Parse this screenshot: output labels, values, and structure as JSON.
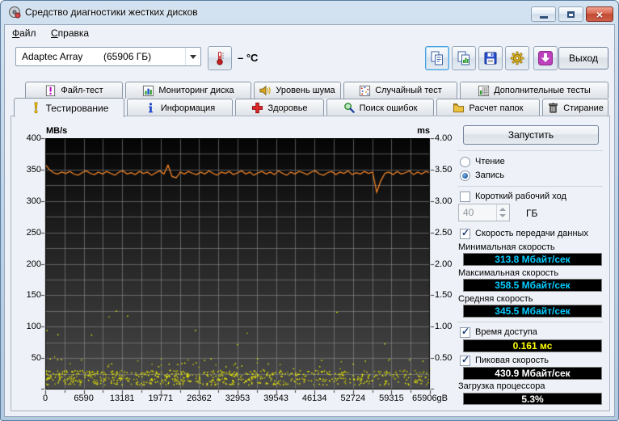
{
  "window": {
    "title": "Средство диагностики жестких дисков"
  },
  "menu": {
    "file": {
      "accel": "Ф",
      "rest": "айл"
    },
    "help": {
      "accel": "С",
      "rest": "правка"
    }
  },
  "toolbar": {
    "drive_name": "Adaptec Array",
    "drive_size": "(65906 ГБ)",
    "temperature": "– °C",
    "exit_label": "Выход"
  },
  "tabs": {
    "row1": [
      {
        "label": "Файл-тест"
      },
      {
        "label": "Мониторинг диска"
      },
      {
        "label": "Уровень шума"
      },
      {
        "label": "Случайный тест"
      },
      {
        "label": "Дополнительные тесты"
      }
    ],
    "row2": [
      {
        "label": "Тестирование",
        "active": true
      },
      {
        "label": "Информация"
      },
      {
        "label": "Здоровье"
      },
      {
        "label": "Поиск ошибок"
      },
      {
        "label": "Расчет папок"
      },
      {
        "label": "Стирание"
      }
    ]
  },
  "panel": {
    "start_button": "Запустить",
    "radio_read": "Чтение",
    "read_selected": false,
    "radio_write": "Запись",
    "write_selected": true,
    "short_stroke_label": "Короткий рабочий ход",
    "short_stroke_checked": false,
    "short_stroke_value": "40",
    "short_stroke_unit": "ГБ",
    "transfer_label": "Скорость передачи данных",
    "transfer_checked": true,
    "min_speed_label": "Минимальная скорость",
    "min_speed_value": "313.8 Мбайт/сек",
    "max_speed_label": "Максимальная скорость",
    "max_speed_value": "358.5 Мбайт/сек",
    "avg_speed_label": "Средняя скорость",
    "avg_speed_value": "345.5 Мбайт/сек",
    "access_time_label": "Время доступа",
    "access_time_checked": true,
    "access_time_value": "0.161 мс",
    "burst_label": "Пиковая скорость",
    "burst_checked": true,
    "burst_value": "430.9 Мбайт/сек",
    "cpu_label": "Загрузка процессора",
    "cpu_value": "5.3%"
  },
  "chart_data": {
    "type": "line+scatter",
    "left_axis": {
      "label": "MB/s",
      "min": 0,
      "max": 400,
      "ticks": [
        400,
        350,
        300,
        250,
        200,
        150,
        100,
        50
      ]
    },
    "right_axis": {
      "label": "ms",
      "min": 0,
      "max": 4,
      "ticks": [
        "4.00",
        "3.50",
        "3.00",
        "2.50",
        "2.00",
        "1.50",
        "1.00",
        "0.50"
      ]
    },
    "x_axis": {
      "min": 0,
      "max": 65906,
      "tick_labels": [
        "0",
        "6590",
        "13181",
        "19771",
        "26362",
        "32953",
        "39543",
        "46134",
        "52724",
        "59315",
        "65906gB"
      ]
    },
    "series": [
      {
        "name": "Скорость передачи данных",
        "unit": "MB/s",
        "color": "#ff8a28",
        "values": [
          358.5,
          350,
          345,
          343,
          346,
          344,
          347,
          343,
          341,
          345,
          348,
          344,
          342,
          346,
          343,
          347,
          344,
          341,
          346,
          348,
          343,
          345,
          342,
          347,
          344,
          346,
          341,
          345,
          348,
          343,
          357,
          339,
          337,
          346,
          343,
          347,
          344,
          342,
          346,
          343,
          348,
          344,
          341,
          346,
          344,
          347,
          342,
          345,
          348,
          343,
          346,
          341,
          345,
          347,
          343,
          346,
          342,
          348,
          344,
          341,
          346,
          343,
          347,
          345,
          342,
          346,
          348,
          343,
          341,
          345,
          347,
          342,
          346,
          344,
          348,
          342,
          345,
          343,
          347,
          344,
          346,
          313.8,
          332,
          344,
          346,
          342,
          347,
          343,
          345,
          348,
          342,
          346,
          343,
          347,
          345
        ]
      },
      {
        "name": "Время доступа",
        "unit": "ms",
        "color": "#ffff00",
        "typical": 0.161,
        "spread": [
          0.08,
          0.35
        ],
        "outlier_max": 1.3,
        "count": 900,
        "seed": 7
      }
    ],
    "colors": {
      "bg_top": "#050505",
      "bg_bottom": "#4a4a4a",
      "grid": "#8c8c8c",
      "value_cyan": "#00ccff",
      "value_yellow": "#ffff00",
      "value_white": "#ffffff"
    }
  }
}
